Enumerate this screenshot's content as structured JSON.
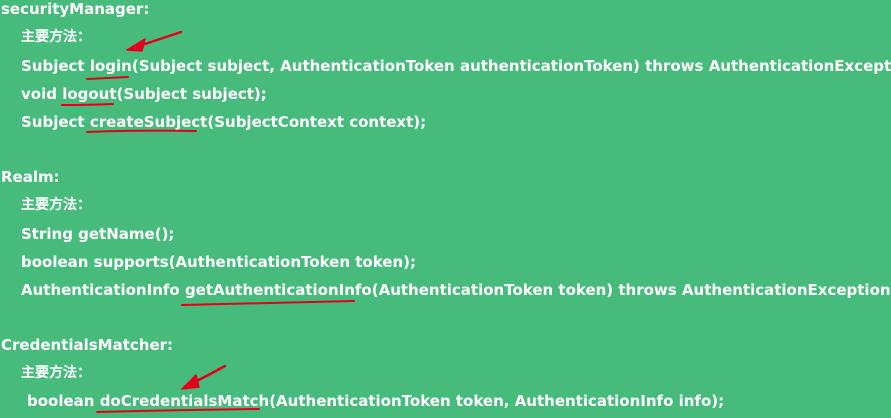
{
  "security_manager": {
    "heading": "securityManager:",
    "methods_label": "主要方法：",
    "login_prefix": "Subject ",
    "login_name": "login",
    "login_suffix": "(Subject subject, AuthenticationToken authenticationToken) throws AuthenticationException;",
    "logout_prefix": "void ",
    "logout_name": "logout",
    "logout_suffix": "(Subject subject);",
    "create_prefix": "Subject ",
    "create_name": "createSubject",
    "create_suffix": "(SubjectContext context);"
  },
  "realm": {
    "heading": "Realm:",
    "methods_label": "主要方法：",
    "getname": "String getName();",
    "supports": "boolean supports(AuthenticationToken token);",
    "getinfo_prefix": "AuthenticationInfo ",
    "getinfo_name": "getAuthenticationInfo",
    "getinfo_suffix": "(AuthenticationToken token) throws AuthenticationException;"
  },
  "credentials_matcher": {
    "heading": "CredentialsMatcher:",
    "methods_label": "主要方法：",
    "match_prefix": "boolean ",
    "match_name": "doCredentialsMatch",
    "match_suffix": "(AuthenticationToken token, AuthenticationInfo info);"
  },
  "annotation_color": "#e3001b"
}
